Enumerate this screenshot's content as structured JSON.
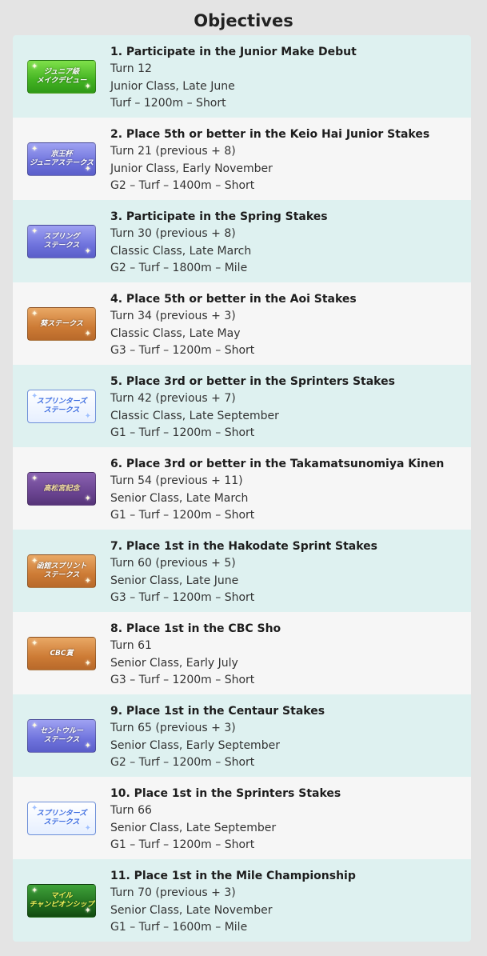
{
  "title": "Objectives",
  "objectives": [
    {
      "badge": "ジュニア級\nメイクデビュー",
      "badge_style": "green",
      "heading": "1. Participate in the Junior Make Debut",
      "turn": "Turn 12",
      "timing": "Junior Class, Late June",
      "race": "Turf – 1200m – Short"
    },
    {
      "badge": "京王杯\nジュニアステークス",
      "badge_style": "blue",
      "heading": "2. Place 5th or better in the Keio Hai Junior Stakes",
      "turn": "Turn 21 (previous + 8)",
      "timing": "Junior Class, Early November",
      "race": "G2 – Turf – 1400m – Short"
    },
    {
      "badge": "スプリング\nステークス",
      "badge_style": "blue",
      "heading": "3. Participate in the Spring Stakes",
      "turn": "Turn 30 (previous + 8)",
      "timing": "Classic Class, Late March",
      "race": "G2 – Turf – 1800m – Mile"
    },
    {
      "badge": "葵ステークス",
      "badge_style": "orange",
      "heading": "4. Place 5th or better in the Aoi Stakes",
      "turn": "Turn 34 (previous + 3)",
      "timing": "Classic Class, Late May",
      "race": "G3 – Turf – 1200m – Short"
    },
    {
      "badge": "スプリンターズ\nステークス",
      "badge_style": "white",
      "heading": "5. Place 3rd or better in the Sprinters Stakes",
      "turn": "Turn 42 (previous + 7)",
      "timing": "Classic Class, Late September",
      "race": "G1 – Turf – 1200m – Short"
    },
    {
      "badge": "高松宮記念",
      "badge_style": "purple",
      "heading": "6. Place 3rd or better in the Takamatsunomiya Kinen",
      "turn": "Turn 54 (previous + 11)",
      "timing": "Senior Class, Late March",
      "race": "G1 – Turf – 1200m – Short"
    },
    {
      "badge": "函館スプリント\nステークス",
      "badge_style": "orange",
      "heading": "7. Place 1st in the Hakodate Sprint Stakes",
      "turn": "Turn 60 (previous + 5)",
      "timing": "Senior Class, Late June",
      "race": "G3 – Turf – 1200m – Short"
    },
    {
      "badge": "CBC賞",
      "badge_style": "orange",
      "heading": "8. Place 1st in the CBC Sho",
      "turn": "Turn 61",
      "timing": "Senior Class, Early July",
      "race": "G3 – Turf – 1200m – Short"
    },
    {
      "badge": "セントウルー\nステークス",
      "badge_style": "blue",
      "heading": "9. Place 1st in the Centaur Stakes",
      "turn": "Turn 65 (previous + 3)",
      "timing": "Senior Class, Early September",
      "race": "G2 – Turf – 1200m – Short"
    },
    {
      "badge": "スプリンターズ\nステークス",
      "badge_style": "white",
      "heading": "10. Place 1st in the Sprinters Stakes",
      "turn": "Turn 66",
      "timing": "Senior Class, Late September",
      "race": "G1 – Turf – 1200m – Short"
    },
    {
      "badge": "マイル\nチャンピオンシップ",
      "badge_style": "dgreen",
      "heading": "11. Place 1st in the Mile Championship",
      "turn": "Turn 70 (previous + 3)",
      "timing": "Senior Class, Late November",
      "race": "G1 – Turf – 1600m – Mile"
    }
  ]
}
